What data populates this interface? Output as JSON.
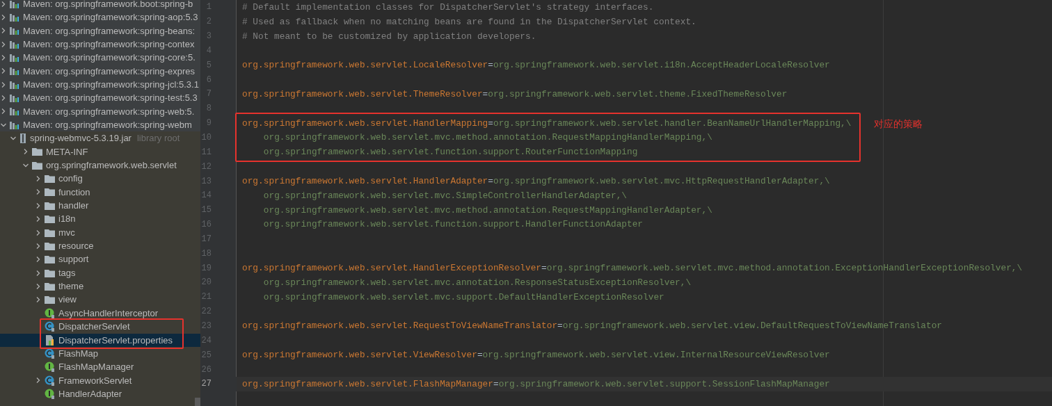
{
  "project_tree": [
    {
      "label": "Maven: org.springframework.boot:spring-b",
      "kind": "maven",
      "expanded": false
    },
    {
      "label": "Maven: org.springframework:spring-aop:5.3",
      "kind": "maven",
      "expanded": false
    },
    {
      "label": "Maven: org.springframework:spring-beans:",
      "kind": "maven",
      "expanded": false
    },
    {
      "label": "Maven: org.springframework:spring-contex",
      "kind": "maven",
      "expanded": false
    },
    {
      "label": "Maven: org.springframework:spring-core:5.",
      "kind": "maven",
      "expanded": false
    },
    {
      "label": "Maven: org.springframework:spring-expres",
      "kind": "maven",
      "expanded": false
    },
    {
      "label": "Maven: org.springframework:spring-jcl:5.3.1",
      "kind": "maven",
      "expanded": false
    },
    {
      "label": "Maven: org.springframework:spring-test:5.3",
      "kind": "maven",
      "expanded": false
    },
    {
      "label": "Maven: org.springframework:spring-web:5.",
      "kind": "maven",
      "expanded": false
    },
    {
      "label": "Maven: org.springframework:spring-webm",
      "kind": "maven",
      "expanded": true,
      "children": [
        {
          "label": "spring-webmvc-5.3.19.jar",
          "suffix": "library root",
          "kind": "jar",
          "expanded": true,
          "children": [
            {
              "label": "META-INF",
              "kind": "folder",
              "expanded": false
            },
            {
              "label": "org.springframework.web.servlet",
              "kind": "folder",
              "expanded": true,
              "children": [
                {
                  "label": "config",
                  "kind": "folder",
                  "expanded": false
                },
                {
                  "label": "function",
                  "kind": "folder",
                  "expanded": false
                },
                {
                  "label": "handler",
                  "kind": "folder",
                  "expanded": false
                },
                {
                  "label": "i18n",
                  "kind": "folder",
                  "expanded": false
                },
                {
                  "label": "mvc",
                  "kind": "folder",
                  "expanded": false
                },
                {
                  "label": "resource",
                  "kind": "folder",
                  "expanded": false
                },
                {
                  "label": "support",
                  "kind": "folder",
                  "expanded": false
                },
                {
                  "label": "tags",
                  "kind": "folder",
                  "expanded": false
                },
                {
                  "label": "theme",
                  "kind": "folder",
                  "expanded": false
                },
                {
                  "label": "view",
                  "kind": "folder",
                  "expanded": false
                },
                {
                  "label": "AsyncHandlerInterceptor",
                  "kind": "interface",
                  "selected": false,
                  "boxed": false
                },
                {
                  "label": "DispatcherServlet",
                  "kind": "class",
                  "selected": false,
                  "boxed": true
                },
                {
                  "label": "DispatcherServlet.properties",
                  "kind": "properties",
                  "selected": true,
                  "boxed": true
                },
                {
                  "label": "FlashMap",
                  "kind": "class",
                  "selected": false,
                  "boxed": false
                },
                {
                  "label": "FlashMapManager",
                  "kind": "interface",
                  "selected": false,
                  "boxed": false
                },
                {
                  "label": "FrameworkServlet",
                  "kind": "class",
                  "expanded": false,
                  "selected": false,
                  "boxed": false
                },
                {
                  "label": "HandlerAdapter",
                  "kind": "interface",
                  "selected": false,
                  "boxed": false
                }
              ]
            }
          ]
        }
      ]
    }
  ],
  "editor": {
    "lines": [
      {
        "number": "1",
        "kind": "comment",
        "text": "# Default implementation classes for DispatcherServlet's strategy interfaces."
      },
      {
        "number": "2",
        "kind": "comment",
        "text": "# Used as fallback when no matching beans are found in the DispatcherServlet context."
      },
      {
        "number": "3",
        "kind": "comment",
        "text": "# Not meant to be customized by application developers."
      },
      {
        "number": "4",
        "kind": "blank"
      },
      {
        "number": "5",
        "kind": "entry",
        "key": "org.springframework.web.servlet.LocaleResolver",
        "sep": "=",
        "value": "org.springframework.web.servlet.i18n.AcceptHeaderLocaleResolver"
      },
      {
        "number": "6",
        "kind": "blank"
      },
      {
        "number": "7",
        "kind": "entry",
        "key": "org.springframework.web.servlet.ThemeResolver",
        "sep": "=",
        "value": "org.springframework.web.servlet.theme.FixedThemeResolver"
      },
      {
        "number": "8",
        "kind": "blank"
      },
      {
        "number": "9",
        "kind": "entry",
        "boxed": true,
        "key": "org.springframework.web.servlet.HandlerMapping",
        "sep": "=",
        "value": "org.springframework.web.servlet.handler.BeanNameUrlHandlerMapping,\\"
      },
      {
        "number": "10",
        "kind": "continuation",
        "boxed": true,
        "value": "org.springframework.web.servlet.mvc.method.annotation.RequestMappingHandlerMapping,\\"
      },
      {
        "number": "11",
        "kind": "continuation",
        "boxed": true,
        "value": "org.springframework.web.servlet.function.support.RouterFunctionMapping"
      },
      {
        "number": "12",
        "kind": "blank"
      },
      {
        "number": "13",
        "kind": "entry",
        "key": "org.springframework.web.servlet.HandlerAdapter",
        "sep": "=",
        "value": "org.springframework.web.servlet.mvc.HttpRequestHandlerAdapter,\\"
      },
      {
        "number": "14",
        "kind": "continuation",
        "value": "org.springframework.web.servlet.mvc.SimpleControllerHandlerAdapter,\\"
      },
      {
        "number": "15",
        "kind": "continuation",
        "value": "org.springframework.web.servlet.mvc.method.annotation.RequestMappingHandlerAdapter,\\"
      },
      {
        "number": "16",
        "kind": "continuation",
        "value": "org.springframework.web.servlet.function.support.HandlerFunctionAdapter"
      },
      {
        "number": "17",
        "kind": "blank"
      },
      {
        "number": "18",
        "kind": "blank"
      },
      {
        "number": "19",
        "kind": "entry",
        "key": "org.springframework.web.servlet.HandlerExceptionResolver",
        "sep": "=",
        "value": "org.springframework.web.servlet.mvc.method.annotation.ExceptionHandlerExceptionResolver,\\"
      },
      {
        "number": "20",
        "kind": "continuation",
        "value": "org.springframework.web.servlet.mvc.annotation.ResponseStatusExceptionResolver,\\"
      },
      {
        "number": "21",
        "kind": "continuation",
        "value": "org.springframework.web.servlet.mvc.support.DefaultHandlerExceptionResolver"
      },
      {
        "number": "22",
        "kind": "blank"
      },
      {
        "number": "23",
        "kind": "entry",
        "key": "org.springframework.web.servlet.RequestToViewNameTranslator",
        "sep": "=",
        "value": "org.springframework.web.servlet.view.DefaultRequestToViewNameTranslator"
      },
      {
        "number": "24",
        "kind": "blank"
      },
      {
        "number": "25",
        "kind": "entry",
        "key": "org.springframework.web.servlet.ViewResolver",
        "sep": "=",
        "value": "org.springframework.web.servlet.view.InternalResourceViewResolver"
      },
      {
        "number": "26",
        "kind": "blank"
      },
      {
        "number": "27",
        "kind": "entry",
        "current": true,
        "key": "org.springframework.web.servlet.FlashMapManager",
        "sep": "=",
        "value": "org.springframework.web.servlet.support.SessionFlashMapManager"
      }
    ],
    "annotation": "对应的策略"
  }
}
